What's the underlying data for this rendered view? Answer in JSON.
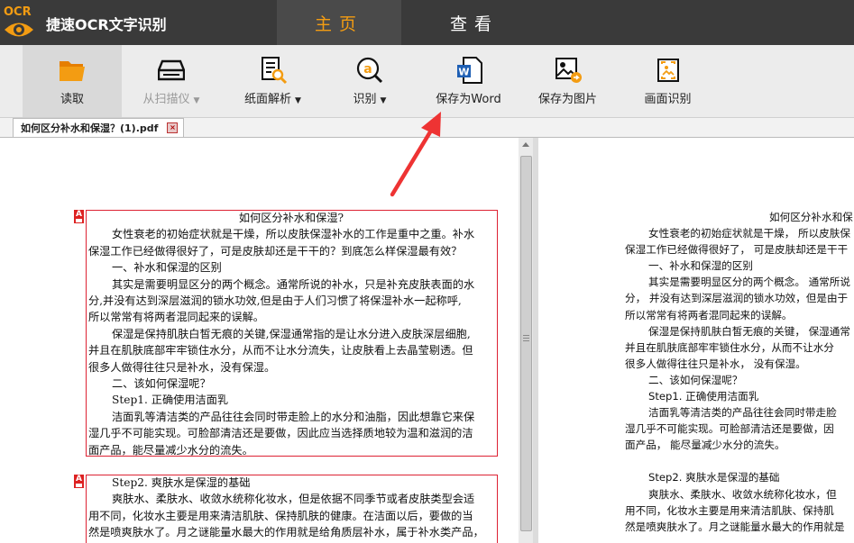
{
  "app": {
    "logo_text": "OCR",
    "title": "捷速OCR文字识别"
  },
  "tabs": [
    {
      "label": "主页",
      "active": true
    },
    {
      "label": "查看",
      "active": false
    }
  ],
  "toolbar": {
    "read": "读取",
    "scan": "从扫描仪",
    "parse": "纸面解析",
    "recognize": "识别",
    "save_word": "保存为Word",
    "save_image": "保存为图片",
    "screen_ocr": "画面识别"
  },
  "document_tab": {
    "name": "如何区分补水和保湿？(1).pdf"
  },
  "colors": {
    "accent": "#f39c12",
    "titlebar": "#3a3a3a",
    "box": "#dd2222",
    "arrow": "#ee3333"
  },
  "left_doc": {
    "block1": [
      "如何区分补水和保湿?",
      "女性衰老的初始症状就是干燥，所以皮肤保湿补水的工作是重中之重。补水",
      "保湿工作已经做得很好了，可是皮肤却还是干干的？到底怎么样保湿最有效？",
      "一、补水和保湿的区别",
      "其实是需要明显区分的两个概念。通常所说的补水，只是补充皮肤表面的水",
      "分,并没有达到深层滋润的锁水功效,但是由于人们习惯了将保湿补水一起称呼,",
      "所以常常有将两者混同起来的误解。",
      "保湿是保持肌肤白皙无痕的关键,保湿通常指的是让水分进入皮肤深层细胞,",
      "并且在肌肤底部牢牢锁住水分，从而不让水分流失，让皮肤看上去晶莹剔透。但",
      "很多人做得往往只是补水，没有保湿。",
      "二、该如何保湿呢？",
      "Step1. 正确使用洁面乳",
      "洁面乳等清洁类的产品往往会同时带走脸上的水分和油脂，因此想靠它来保",
      "湿几乎不可能实现。可脸部清洁还是要做，因此应当选择质地较为温和滋润的洁",
      "面产品，能尽量减少水分的流失。"
    ],
    "block2": [
      "Step2. 爽肤水是保湿的基础",
      "爽肤水、柔肤水、收敛水统称化妆水，但是依据不同季节或者皮肤类型会适",
      "用不同，化妆水主要是用来清洁肌肤、保持肌肤的健康。在洁面以后，要做的当",
      "然是喷爽肤水了。月之谜能量水最大的作用就是给角质层补水，属于补水类产品，"
    ]
  },
  "right_doc": {
    "lines": [
      "如何区分补水和保",
      "女性衰老的初始症状就是干燥， 所以皮肤保",
      "保湿工作已经做得很好了， 可是皮肤却还是干干",
      "一、补水和保湿的区别",
      "其实是需要明显区分的两个概念。 通常所说",
      "分， 并没有达到深层滋润的锁水功效，但是由于",
      "所以常常有将两者混同起来的误解。",
      "保湿是保持肌肤白皙无痕的关键， 保湿通常",
      "并且在肌肤底部牢牢锁住水分，从而不让水分",
      "很多人做得往往只是补水， 没有保湿。",
      "二、该如何保湿呢？",
      "Step1. 正确使用洁面乳",
      "洁面乳等清洁类的产品往往会同时带走脸",
      "湿几乎不可能实现。可脸部清洁还是要做，因",
      "面产品， 能尽量减少水分的流失。",
      "",
      "Step2. 爽肤水是保湿的基础",
      "爽肤水、柔肤水、收敛水统称化妆水，但",
      "用不同，化妆水主要是用来清洁肌肤、保持肌",
      "然是喷爽肤水了。月之谜能量水最大的作用就是"
    ]
  }
}
